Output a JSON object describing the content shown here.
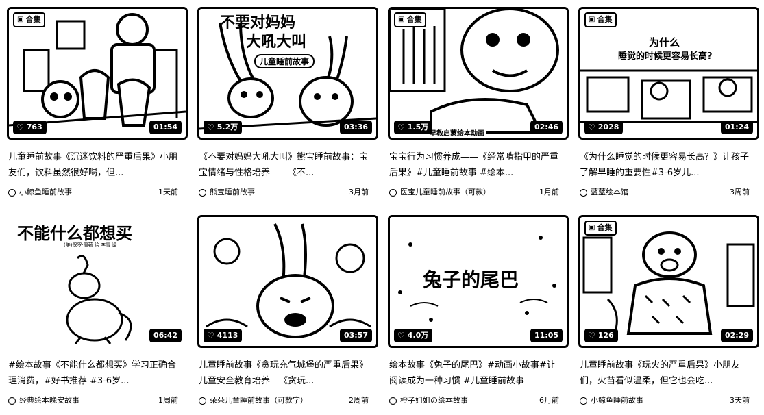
{
  "tag_label": "合集",
  "cards": [
    {
      "has_tag": true,
      "likes": "763",
      "duration": "01:54",
      "title": "儿童睡前故事《沉迷饮料的严重后果》小朋友们，饮料虽然很好喝，但...",
      "author": "小鲸鱼睡前故事",
      "time": "1天前"
    },
    {
      "has_tag": false,
      "likes": "5.2万",
      "duration": "03:36",
      "title": "《不要对妈妈大吼大叫》熊宝睡前故事：宝宝情绪与性格培养——《不...",
      "author": "熊宝睡前故事",
      "time": "3月前",
      "thumb_text_1": "不要对妈妈",
      "thumb_text_2": "大吼大叫",
      "thumb_text_3": "儿童睡前故事"
    },
    {
      "has_tag": true,
      "likes": "1.5万",
      "duration": "02:46",
      "title": "宝宝行为习惯养成——《经常啃指甲的严重后果》#儿童睡前故事 #绘本...",
      "author": "医宝儿童睡前故事（可款）",
      "time": "1月前",
      "thumb_text_1": "早教启蒙绘本动画",
      "thumb_text_2": ""
    },
    {
      "has_tag": true,
      "likes": "2028",
      "duration": "01:24",
      "title": "《为什么睡觉的时候更容易长高？》让孩子了解早睡的重要性#3-6岁儿...",
      "author": "蓝蓝绘本馆",
      "time": "3周前",
      "thumb_text_1": "为什么",
      "thumb_text_2": "睡觉的时候更容易长高?"
    },
    {
      "has_tag": false,
      "likes": "",
      "duration": "06:42",
      "title": "#绘本故事《不能什么都想买》学习正确合理消费，#好书推荐 #3-6岁...",
      "author": "经典绘本晚安故事",
      "time": "1周前",
      "thumb_text_1": "不能什么都想买",
      "thumb_text_2": "(美)保罗·周著  绘 李雪 译"
    },
    {
      "has_tag": false,
      "likes": "4113",
      "duration": "03:57",
      "title": "儿童睡前故事《贪玩充气城堡的严重后果》儿童安全教育培养—《贪玩...",
      "author": "朵朵儿童睡前故事（可款字）",
      "time": "2周前"
    },
    {
      "has_tag": false,
      "likes": "4.0万",
      "duration": "11:05",
      "title": "绘本故事《兔子的尾巴》#动画小故事#让阅读成为一种习惯 #儿童睡前故事",
      "author": "橙子姐姐の绘本故事",
      "time": "6月前",
      "thumb_text_1": "兔子的尾巴"
    },
    {
      "has_tag": true,
      "likes": "126",
      "duration": "02:29",
      "title": "儿童睡前故事《玩火的严重后果》小朋友们，火苗看似温柔，但它也会吃...",
      "author": "小鲸鱼睡前故事",
      "time": "3天前"
    }
  ]
}
